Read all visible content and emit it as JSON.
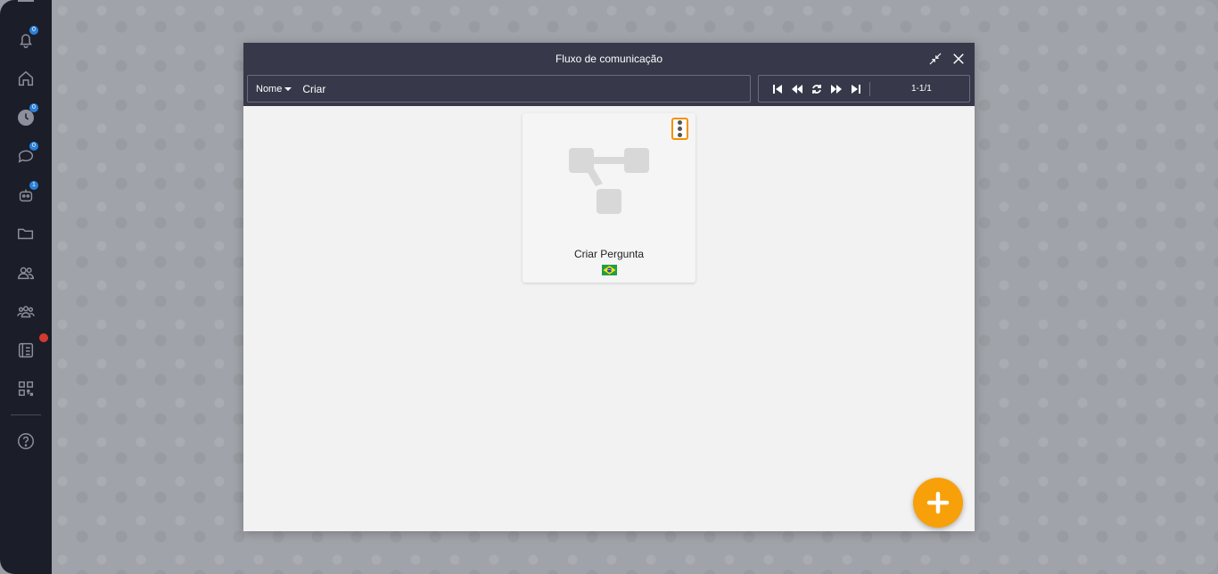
{
  "modal": {
    "title": "Fluxo de comunicação",
    "filter_label": "Nome",
    "search_value": "Criar",
    "pagination": "1-1/1"
  },
  "sidebar": {
    "items": [
      {
        "icon": "bell-icon",
        "badge": "0"
      },
      {
        "icon": "home-icon"
      },
      {
        "icon": "clock-icon",
        "badge": "0"
      },
      {
        "icon": "chat-icon",
        "badge": "0"
      },
      {
        "icon": "robot-icon",
        "badge": "1"
      },
      {
        "icon": "folder-icon"
      },
      {
        "icon": "users-icon"
      },
      {
        "icon": "group-icon"
      },
      {
        "icon": "phone-icon"
      },
      {
        "icon": "qr-code-icon"
      },
      {
        "icon": "help-icon"
      }
    ]
  },
  "cards": [
    {
      "title": "Criar Pergunta",
      "flag": "brazil-flag-icon"
    }
  ],
  "colors": {
    "sidebar": "#1b1d29",
    "header": "#373849",
    "accent": "#f7a00a",
    "badge": "#2a80d8",
    "alert": "#d33a2e"
  }
}
